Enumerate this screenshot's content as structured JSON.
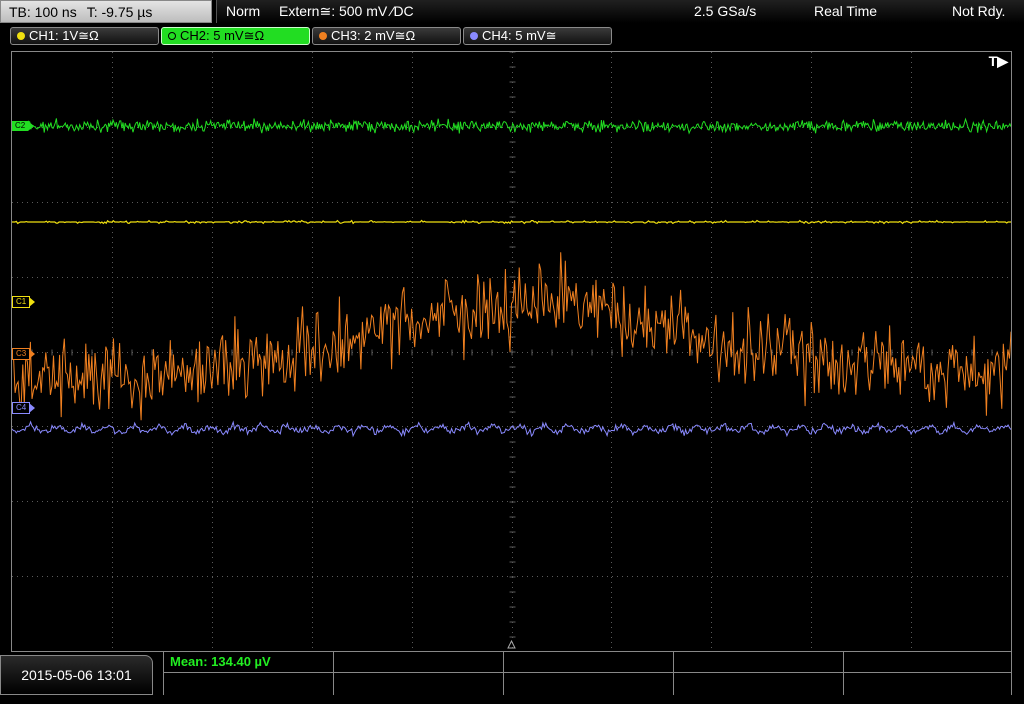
{
  "header": {
    "timebase": "TB: 100 ns",
    "trigger_time": "T: -9.75 µs",
    "mode": "Norm",
    "trigger_source": "Extern≅: 500 mV ⁄DC",
    "sample_rate": "2.5 GSa/s",
    "acquisition": "Real Time",
    "status": "Not Rdy."
  },
  "channels": [
    {
      "label": "CH1: 1V≅Ω",
      "color": "#f0e010",
      "active": false
    },
    {
      "label": "CH2: 5 mV≅Ω",
      "color": "#22dd22",
      "active": true
    },
    {
      "label": "CH3: 2 mV≅Ω",
      "color": "#f08020",
      "active": false
    },
    {
      "label": "CH4: 5 mV≅",
      "color": "#8a8aff",
      "active": false
    }
  ],
  "markers": {
    "c1": "C1",
    "c2": "C2",
    "c3": "C3",
    "c4": "C4"
  },
  "trigger_marker": "T▶",
  "footer": {
    "datetime": "2015-05-06 13:01",
    "measurement": "Mean: 134.40 µV"
  },
  "colors": {
    "ch1": "#f0e010",
    "ch2": "#22dd22",
    "ch3": "#f08020",
    "ch4": "#8a8aff",
    "grid": "#5a5a5a"
  }
}
